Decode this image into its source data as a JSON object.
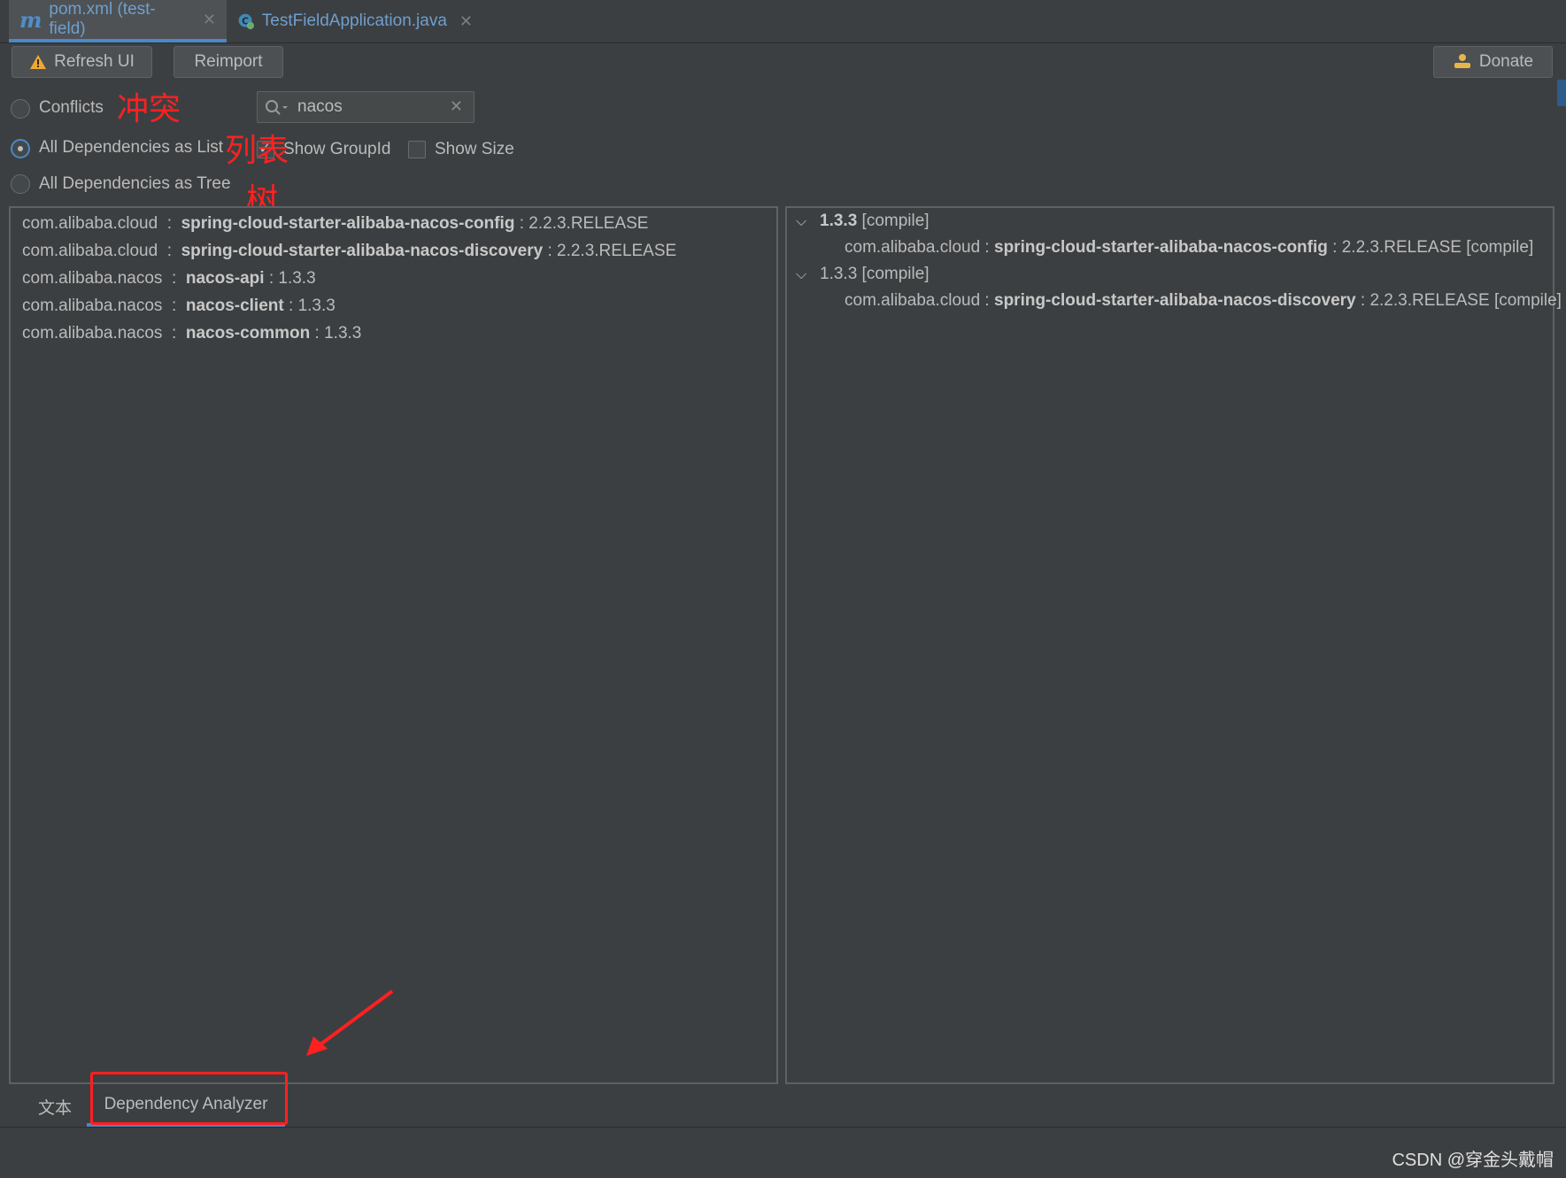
{
  "tabs": [
    {
      "label": "pom.xml (test-field)",
      "icon": "maven-m-icon",
      "active": true
    },
    {
      "label": "TestFieldApplication.java",
      "icon": "spring-class-icon",
      "active": false
    }
  ],
  "toolbar": {
    "refresh_label": "Refresh UI",
    "reimport_label": "Reimport",
    "donate_label": "Donate"
  },
  "options": {
    "conflicts_label": "Conflicts",
    "list_label": "All Dependencies as List",
    "tree_label": "All Dependencies as Tree",
    "selected": "list",
    "show_groupid_label": "Show GroupId",
    "show_groupid_checked": true,
    "show_size_label": "Show Size",
    "show_size_checked": false
  },
  "annotations": {
    "conflicts_note": "冲突",
    "list_note": "列表",
    "tree_note": "树"
  },
  "search": {
    "value": "nacos"
  },
  "left_list": [
    {
      "group": "com.alibaba.cloud",
      "artifact": "spring-cloud-starter-alibaba-nacos-config",
      "version": "2.2.3.RELEASE"
    },
    {
      "group": "com.alibaba.cloud",
      "artifact": "spring-cloud-starter-alibaba-nacos-discovery",
      "version": "2.2.3.RELEASE"
    },
    {
      "group": "com.alibaba.nacos",
      "artifact": "nacos-api",
      "version": "1.3.3"
    },
    {
      "group": "com.alibaba.nacos",
      "artifact": "nacos-client",
      "version": "1.3.3"
    },
    {
      "group": "com.alibaba.nacos",
      "artifact": "nacos-common",
      "version": "1.3.3"
    }
  ],
  "right_tree": [
    {
      "version": "1.3.3",
      "scope": "[compile]",
      "bold": true,
      "child": {
        "group": "com.alibaba.cloud",
        "artifact": "spring-cloud-starter-alibaba-nacos-config",
        "version": "2.2.3.RELEASE",
        "scope": "[compile]"
      }
    },
    {
      "version": "1.3.3",
      "scope": "[compile]",
      "bold": false,
      "child": {
        "group": "com.alibaba.cloud",
        "artifact": "spring-cloud-starter-alibaba-nacos-discovery",
        "version": "2.2.3.RELEASE",
        "scope": "[compile]"
      }
    }
  ],
  "bottom_tabs": {
    "text_tab": "文本",
    "analyzer_tab": "Dependency Analyzer"
  },
  "watermark": "CSDN @穿金头戴帽",
  "colors": {
    "accent": "#4a88c7",
    "annotation_red": "#ff2020",
    "background": "#3c3f41"
  }
}
